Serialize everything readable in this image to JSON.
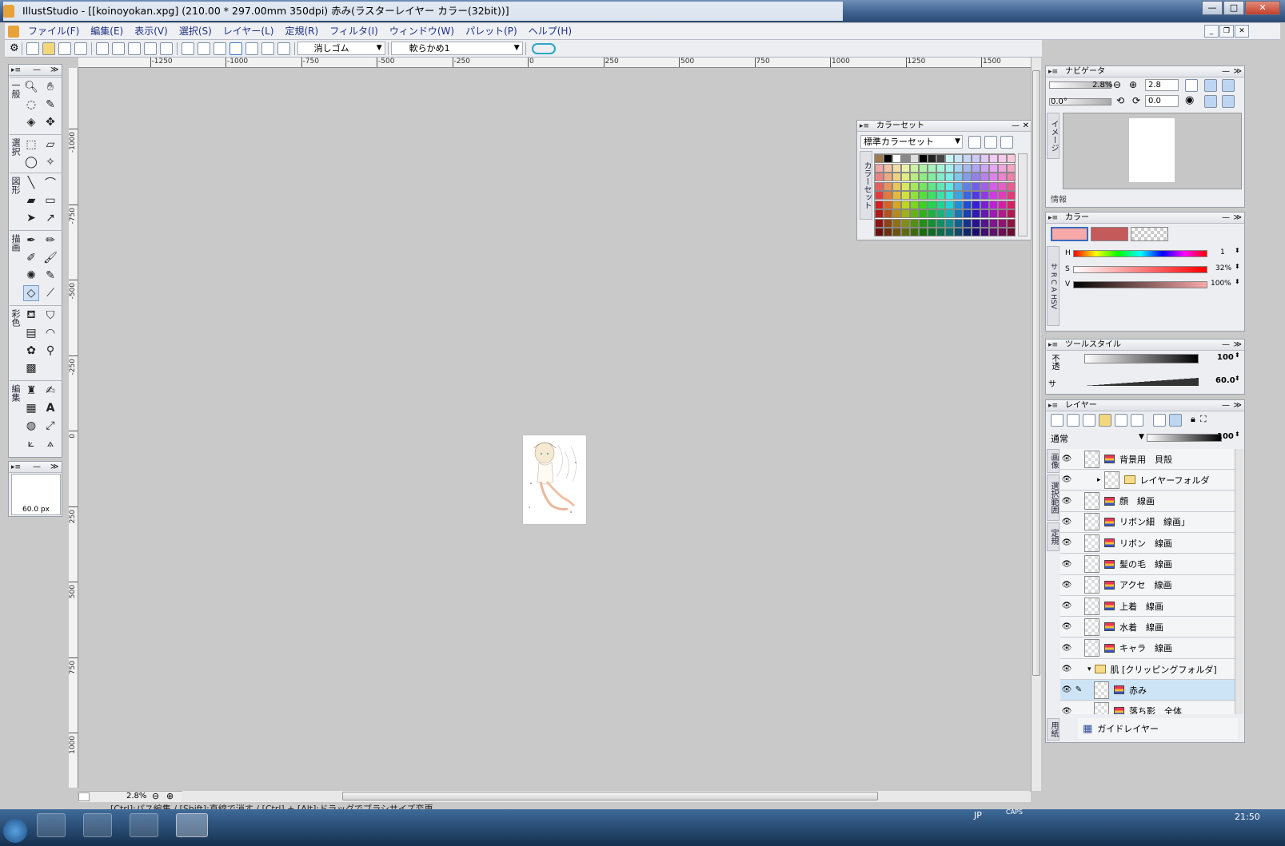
{
  "window": {
    "title": "IllustStudio - [[koinoyokan.xpg] (210.00 * 297.00mm 350dpi)    赤み(ラスターレイヤー カラー(32bit))]",
    "min": "—",
    "max": "□",
    "close": "✕"
  },
  "menu": [
    "ファイル(F)",
    "編集(E)",
    "表示(V)",
    "選択(S)",
    "レイヤー(L)",
    "定規(R)",
    "フィルタ(I)",
    "ウィンドウ(W)",
    "パレット(P)",
    "ヘルプ(H)"
  ],
  "toolbar": {
    "tool_name": "消しゴム",
    "brush_name": "軟らかめ1"
  },
  "ruler": {
    "top_labels": [
      "-1250",
      "-1000",
      "-750",
      "-500",
      "-250",
      "0",
      "250",
      "500",
      "750",
      "1000",
      "1250",
      "1500"
    ],
    "left_labels": [
      "-1000",
      "-750",
      "-500",
      "-250",
      "0",
      "250",
      "500",
      "750",
      "1000"
    ]
  },
  "toolbox": {
    "groups": [
      "一般",
      "選択",
      "図形",
      "描画",
      "彩色",
      "編集"
    ]
  },
  "brush_size": {
    "value": "60.0 px"
  },
  "status": {
    "zoom": "2.8%",
    "hint": "[Ctrl]:パス編集 / [Shift]:直線で消す / [Ctrl] + [Alt]:ドラッグでブラシサイズ変更"
  },
  "color_set": {
    "title": "カラーセット",
    "preset": "標準カラーセット",
    "vtab": "カラーセット"
  },
  "navigator": {
    "title": "ナビゲータ",
    "zoom_pct": "2.8%",
    "zoom_value": "2.8",
    "angle_slider": "0.0°",
    "angle_value": "0.0",
    "vtab": "イメージ",
    "info": "情報"
  },
  "color_panel": {
    "title": "カラー",
    "vtabs": [
      "サ",
      "R",
      "C",
      "A",
      "HSV"
    ],
    "h_label": "H",
    "h_value": "1",
    "s_label": "S",
    "s_value": "32%",
    "v_label": "V",
    "v_value": "100%",
    "main_color": "#f7a9a9",
    "sub_color": "#c45a5a"
  },
  "tool_style": {
    "title": "ツールスタイル",
    "opacity_label": "不透",
    "opacity_value": "100",
    "size_label": "サ",
    "size_value": "60.0"
  },
  "layers": {
    "title": "レイヤー",
    "blend_mode": "通常",
    "opacity": "100",
    "vtabs": [
      "画像",
      "選択範囲",
      "定規"
    ],
    "bottom_vtab": "用紙",
    "items": [
      {
        "name": "背景用　貝殻",
        "kind": "raster",
        "indent": 0,
        "selected": false
      },
      {
        "name": "レイヤーフォルダ",
        "kind": "folder",
        "indent": 1,
        "selected": false
      },
      {
        "name": "顔　線画",
        "kind": "raster",
        "indent": 0,
        "selected": false
      },
      {
        "name": "リボン細　線画」",
        "kind": "raster",
        "indent": 0,
        "selected": false
      },
      {
        "name": "リボン　線画",
        "kind": "raster",
        "indent": 0,
        "selected": false
      },
      {
        "name": "髪の毛　線画",
        "kind": "raster",
        "indent": 0,
        "selected": false
      },
      {
        "name": "アクセ　線画",
        "kind": "raster",
        "indent": 0,
        "selected": false
      },
      {
        "name": "上着　線画",
        "kind": "raster",
        "indent": 0,
        "selected": false
      },
      {
        "name": "水着　線画",
        "kind": "raster",
        "indent": 0,
        "selected": false
      },
      {
        "name": "キャラ　線画",
        "kind": "raster",
        "indent": 0,
        "selected": false
      },
      {
        "name": "肌 [クリッピングフォルダ]",
        "kind": "folder",
        "indent": 0,
        "selected": false
      },
      {
        "name": "赤み",
        "kind": "raster",
        "indent": 1,
        "selected": true
      },
      {
        "name": "落ち影　全体",
        "kind": "raster",
        "indent": 1,
        "selected": false
      }
    ],
    "guide_layer": "ガイドレイヤー"
  },
  "taskbar": {
    "lang": "JP",
    "caps": "CAPS",
    "clock": "21:50"
  }
}
